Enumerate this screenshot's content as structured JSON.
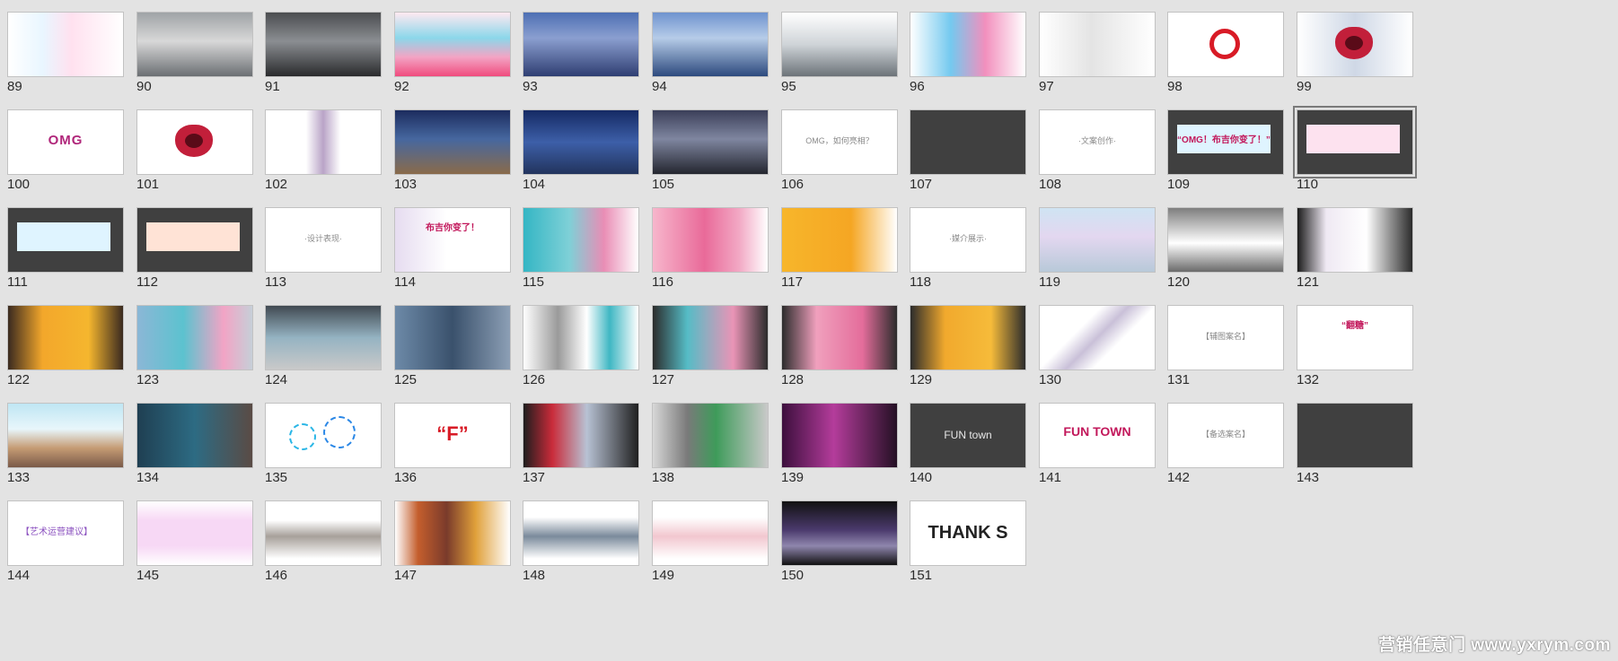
{
  "watermark": "营销任意门 www.yxrym.com",
  "slides": [
    {
      "num": "89",
      "row": 0,
      "col": 0,
      "bg": "linear-gradient(90deg,#ffffff 0%,#e9f6ff 30%,#ffe1ef 55%,#ffffff 100%)",
      "caption": "",
      "style": "plain"
    },
    {
      "num": "90",
      "row": 0,
      "col": 1,
      "bg": "linear-gradient(180deg,#9fa3a6 0%,#d8d8d8 45%,#6b6f73 100%)",
      "caption": "",
      "style": "plain"
    },
    {
      "num": "91",
      "row": 0,
      "col": 2,
      "bg": "linear-gradient(180deg,#4b4d50 0%,#8b8e92 45%,#2a2b2d 100%)",
      "caption": "",
      "style": "plain"
    },
    {
      "num": "92",
      "row": 0,
      "col": 3,
      "bg": "linear-gradient(180deg,#ffe9f1 0%,#8bd7ea 40%,#f3a4c4 70%,#f04c7e 100%)",
      "caption": "",
      "style": "plain"
    },
    {
      "num": "93",
      "row": 0,
      "col": 4,
      "bg": "linear-gradient(180deg,#4d6fb3 0%,#8b9fd0 40%,#2f3e72 100%)",
      "caption": "",
      "style": "plain"
    },
    {
      "num": "94",
      "row": 0,
      "col": 5,
      "bg": "linear-gradient(180deg,#6f93cf 0%,#b6cce8 40%,#2d4a7e 100%)",
      "caption": "",
      "style": "plain"
    },
    {
      "num": "95",
      "row": 0,
      "col": 6,
      "bg": "linear-gradient(180deg,#ffffff 0%,#cfd4d8 50%,#6c7379 100%)",
      "caption": "",
      "style": "plain"
    },
    {
      "num": "96",
      "row": 0,
      "col": 7,
      "bg": "linear-gradient(90deg,#ffffff 0%,#74c9ef 35%,#f28fbd 65%,#ffffff 100%)",
      "caption": "",
      "style": "plain"
    },
    {
      "num": "97",
      "row": 0,
      "col": 8,
      "bg": "linear-gradient(90deg,#ffffff 0%,#e4e4e4 45%,#ffffff 100%)",
      "caption": "",
      "style": "plain"
    },
    {
      "num": "98",
      "row": 0,
      "col": 9,
      "bg": "#ffffff",
      "caption": "",
      "style": "ring"
    },
    {
      "num": "99",
      "row": 0,
      "col": 10,
      "bg": "linear-gradient(90deg,#ffffff 0%,#cfd8e6 50%,#ffffff 100%)",
      "caption": "",
      "style": "mouth"
    },
    {
      "num": "100",
      "row": 1,
      "col": 0,
      "bg": "#ffffff",
      "caption": "OMG",
      "style": "wide"
    },
    {
      "num": "101",
      "row": 1,
      "col": 1,
      "bg": "#ffffff",
      "caption": "",
      "style": "mouth"
    },
    {
      "num": "102",
      "row": 1,
      "col": 2,
      "bg": "linear-gradient(90deg,#ffffff 0%,#ffffff 35%,#b9a4c7 50%,#ffffff 65%)",
      "caption": "",
      "style": "plain"
    },
    {
      "num": "103",
      "row": 1,
      "col": 3,
      "bg": "linear-gradient(180deg,#1c2c5e 0%,#46679f 45%,#8a6b4a 100%)",
      "caption": "",
      "style": "plain"
    },
    {
      "num": "104",
      "row": 1,
      "col": 4,
      "bg": "linear-gradient(180deg,#152a64 0%,#3d5fa8 50%,#22345d 100%)",
      "caption": "",
      "style": "plain"
    },
    {
      "num": "105",
      "row": 1,
      "col": 5,
      "bg": "linear-gradient(180deg,#3b3f59 0%,#7f86a0 45%,#24262f 100%)",
      "caption": "",
      "style": "plain"
    },
    {
      "num": "106",
      "row": 1,
      "col": 6,
      "bg": "#ffffff",
      "caption": "OMG，如何亮相？",
      "style": "caption"
    },
    {
      "num": "107",
      "row": 1,
      "col": 7,
      "bg": "#404040",
      "caption": "",
      "style": "dark"
    },
    {
      "num": "108",
      "row": 1,
      "col": 8,
      "bg": "#ffffff",
      "caption": "·文案创作·",
      "style": "caption"
    },
    {
      "num": "109",
      "row": 1,
      "col": 9,
      "bg": "#404040",
      "caption": "“OMG！布吉你变了！”",
      "style": "banner-blue"
    },
    {
      "num": "110",
      "row": 1,
      "col": 10,
      "bg": "#404040",
      "caption": "",
      "style": "banner-pink",
      "selected": true
    },
    {
      "num": "111",
      "row": 2,
      "col": 0,
      "bg": "#404040",
      "caption": "",
      "style": "banner-blue"
    },
    {
      "num": "112",
      "row": 2,
      "col": 1,
      "bg": "#404040",
      "caption": "",
      "style": "banner-peach"
    },
    {
      "num": "113",
      "row": 2,
      "col": 2,
      "bg": "#ffffff",
      "caption": "·设计表现·",
      "style": "caption"
    },
    {
      "num": "114",
      "row": 2,
      "col": 3,
      "bg": "linear-gradient(90deg,#e6dcf0 0%,#ffffff 45%,#ffffff 100%)",
      "caption": "布吉你变了！",
      "style": "ribbon"
    },
    {
      "num": "115",
      "row": 2,
      "col": 4,
      "bg": "linear-gradient(90deg,#34b6c4 0%,#7fd0d7 40%,#e98db5 70%,#ffffff 100%)",
      "caption": "",
      "style": "plain"
    },
    {
      "num": "116",
      "row": 2,
      "col": 5,
      "bg": "linear-gradient(90deg,#f7b6cc 0%,#e96a99 45%,#f2a8c4 75%,#ffffff 100%)",
      "caption": "",
      "style": "plain"
    },
    {
      "num": "117",
      "row": 2,
      "col": 6,
      "bg": "linear-gradient(90deg,#f7b62b 0%,#f5a623 60%,#ffffff 100%)",
      "caption": "",
      "style": "plain"
    },
    {
      "num": "118",
      "row": 2,
      "col": 7,
      "bg": "#ffffff",
      "caption": "·媒介展示·",
      "style": "caption"
    },
    {
      "num": "119",
      "row": 2,
      "col": 8,
      "bg": "linear-gradient(180deg,#cfe4f3 0%,#e3d7f0 45%,#b8c9d9 100%)",
      "caption": "",
      "style": "plain"
    },
    {
      "num": "120",
      "row": 2,
      "col": 9,
      "bg": "linear-gradient(180deg,#7e7e7e 0%,#dcdcdc 40%,#ffffff 55%,#6a6a6a 100%)",
      "caption": "",
      "style": "plain"
    },
    {
      "num": "121",
      "row": 2,
      "col": 10,
      "bg": "linear-gradient(90deg,#1c1c1c 0%,#efe9f3 25%,#ffffff 60%,#2b2b2b 100%)",
      "caption": "",
      "style": "plain"
    },
    {
      "num": "122",
      "row": 3,
      "col": 0,
      "bg": "linear-gradient(90deg,#3a2a20 0%,#f3a72b 30%,#f5b62e 70%,#3a2a20 100%)",
      "caption": "",
      "style": "plain"
    },
    {
      "num": "123",
      "row": 3,
      "col": 1,
      "bg": "linear-gradient(90deg,#8bb7d6 0%,#5cc2cf 40%,#f2a4c5 75%,#c6cfd8 100%)",
      "caption": "",
      "style": "plain"
    },
    {
      "num": "124",
      "row": 3,
      "col": 2,
      "bg": "linear-gradient(180deg,#414a52 0%,#95b3c2 50%,#c9c9c9 100%)",
      "caption": "",
      "style": "plain"
    },
    {
      "num": "125",
      "row": 3,
      "col": 3,
      "bg": "linear-gradient(90deg,#6d8aa8 0%,#3a516c 50%,#8c9fb5 100%)",
      "caption": "",
      "style": "plain"
    },
    {
      "num": "126",
      "row": 3,
      "col": 4,
      "bg": "linear-gradient(90deg,#ffffff 0%,#9a9a9a 30%,#ffffff 55%,#3fb7c3 75%,#ffffff 100%)",
      "caption": "",
      "style": "plain"
    },
    {
      "num": "127",
      "row": 3,
      "col": 5,
      "bg": "linear-gradient(90deg,#2c2c2c 0%,#55bcc6 30%,#e994b6 70%,#2c2c2c 100%)",
      "caption": "",
      "style": "plain"
    },
    {
      "num": "128",
      "row": 3,
      "col": 6,
      "bg": "linear-gradient(90deg,#2c2c2c 0%,#f0a0bd 30%,#e46d9b 70%,#2c2c2c 100%)",
      "caption": "",
      "style": "plain"
    },
    {
      "num": "129",
      "row": 3,
      "col": 7,
      "bg": "linear-gradient(90deg,#2c2c2c 0%,#f1a92d 30%,#f6bb3a 70%,#2c2c2c 100%)",
      "caption": "",
      "style": "plain"
    },
    {
      "num": "130",
      "row": 3,
      "col": 8,
      "bg": "linear-gradient(135deg,#ffffff 0%,#ffffff 35%,#c9c0d8 50%,#ffffff 65%)",
      "caption": "",
      "style": "plain"
    },
    {
      "num": "131",
      "row": 3,
      "col": 9,
      "bg": "#ffffff",
      "caption": "【辅图案名】",
      "style": "caption"
    },
    {
      "num": "132",
      "row": 3,
      "col": 10,
      "bg": "#ffffff",
      "caption": "“翻糖”",
      "style": "ribbon"
    },
    {
      "num": "133",
      "row": 4,
      "col": 0,
      "bg": "linear-gradient(180deg,#bfe6f3 0%,#e8f6fb 40%,#c59b73 70%,#7a5a49 100%)",
      "caption": "",
      "style": "plain"
    },
    {
      "num": "134",
      "row": 4,
      "col": 1,
      "bg": "linear-gradient(90deg,#1f3f52 0%,#2d6b83 50%,#5a4b45 100%)",
      "caption": "",
      "style": "plain"
    },
    {
      "num": "135",
      "row": 4,
      "col": 2,
      "bg": "#ffffff",
      "caption": "",
      "style": "circles"
    },
    {
      "num": "136",
      "row": 4,
      "col": 3,
      "bg": "#ffffff",
      "caption": "“F”",
      "style": "red-big"
    },
    {
      "num": "137",
      "row": 4,
      "col": 4,
      "bg": "linear-gradient(90deg,#1d1d1d 0%,#c92b3a 25%,#b8c2d4 55%,#202020 100%)",
      "caption": "",
      "style": "plain"
    },
    {
      "num": "138",
      "row": 4,
      "col": 5,
      "bg": "linear-gradient(90deg,#d7d7d7 0%,#7a7a7a 30%,#3e9b5a 55%,#c9c9c9 100%)",
      "caption": "",
      "style": "plain"
    },
    {
      "num": "139",
      "row": 4,
      "col": 6,
      "bg": "linear-gradient(90deg,#3c0f3d 0%,#b43c9b 45%,#241024 100%)",
      "caption": "",
      "style": "plain"
    },
    {
      "num": "140",
      "row": 4,
      "col": 7,
      "bg": "#404040",
      "caption": "FUN town",
      "style": "dark-title"
    },
    {
      "num": "141",
      "row": 4,
      "col": 8,
      "bg": "#ffffff",
      "caption": "FUN TOWN",
      "style": "fun-title"
    },
    {
      "num": "142",
      "row": 4,
      "col": 9,
      "bg": "#ffffff",
      "caption": "【备选案名】",
      "style": "caption"
    },
    {
      "num": "143",
      "row": 4,
      "col": 10,
      "bg": "#404040",
      "caption": "",
      "style": "dark"
    },
    {
      "num": "144",
      "row": 5,
      "col": 0,
      "bg": "#ffffff",
      "caption": "【艺术运营建议】",
      "style": "tiny-left"
    },
    {
      "num": "145",
      "row": 5,
      "col": 1,
      "bg": "linear-gradient(180deg,#ffffff 0%,#f7d8f5 30%,#f7d8f5 70%,#ffffff 100%)",
      "caption": "",
      "style": "plain"
    },
    {
      "num": "146",
      "row": 5,
      "col": 2,
      "bg": "linear-gradient(180deg,#ffffff 0%,#ffffff 30%,#a7a09a 55%,#ffffff 90%)",
      "caption": "",
      "style": "plain"
    },
    {
      "num": "147",
      "row": 5,
      "col": 3,
      "bg": "linear-gradient(90deg,#ffffff 0%,#c45e2d 20%,#7a3b2b 45%,#e0a03a 70%,#ffffff 100%)",
      "caption": "",
      "style": "plain"
    },
    {
      "num": "148",
      "row": 5,
      "col": 4,
      "bg": "linear-gradient(180deg,#ffffff 0%,#ffffff 25%,#7a8a9b 55%,#ffffff 90%)",
      "caption": "",
      "style": "plain"
    },
    {
      "num": "149",
      "row": 5,
      "col": 5,
      "bg": "linear-gradient(180deg,#ffffff 0%,#ffffff 25%,#f2c7cf 55%,#ffffff 90%)",
      "caption": "",
      "style": "plain"
    },
    {
      "num": "150",
      "row": 5,
      "col": 6,
      "bg": "linear-gradient(180deg,#111111 0%,#4b3a6d 45%,#8f86ad 70%,#111111 100%)",
      "caption": "",
      "style": "plain"
    },
    {
      "num": "151",
      "row": 5,
      "col": 7,
      "bg": "#ffffff",
      "caption": "THANK S",
      "style": "big"
    }
  ]
}
